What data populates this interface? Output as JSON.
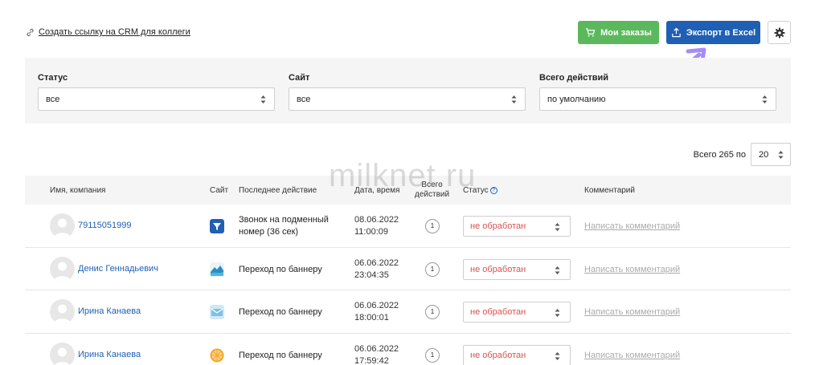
{
  "header": {
    "crm_link": "Создать ссылку на CRM для коллеги",
    "orders_button": "Мои заказы",
    "export_button": "Экспорт в Excel",
    "colors": {
      "green": "#5cb85c",
      "blue": "#1f5fb4",
      "arrow": "#a78bfa"
    }
  },
  "filters": {
    "status": {
      "label": "Статус",
      "value": "все"
    },
    "site": {
      "label": "Сайт",
      "value": "все"
    },
    "actions": {
      "label": "Всего действий",
      "value": "по умолчанию"
    }
  },
  "pagination": {
    "total": "Всего 265 по",
    "per_page": "20"
  },
  "watermark": "milknet.ru",
  "table": {
    "headers": {
      "name": "Имя, компания",
      "site": "Сайт",
      "last_action": "Последнее действие",
      "datetime": "Дата, время",
      "actions_line1": "Всего",
      "actions_line2": "действий",
      "status": "Статус",
      "comment": "Комментарий"
    },
    "rows": [
      {
        "name": "79115051999",
        "site_icon": "funnel-site-icon",
        "last_action": "Звонок на подменный номер (36 сек)",
        "date": "08.06.2022",
        "time": "11:00:09",
        "count": "1",
        "status": "не обработан",
        "comment": "Написать комментарий"
      },
      {
        "name": "Денис Геннадьевич",
        "site_icon": "wave-site-icon",
        "last_action": "Переход по баннеру",
        "date": "06.06.2022",
        "time": "23:04:35",
        "count": "1",
        "status": "не обработан",
        "comment": "Написать комментарий"
      },
      {
        "name": "Ирина Канаева",
        "site_icon": "envelope-site-icon",
        "last_action": "Переход по баннеру",
        "date": "06.06.2022",
        "time": "18:00:01",
        "count": "1",
        "status": "не обработан",
        "comment": "Написать комментарий"
      },
      {
        "name": "Ирина Канаева",
        "site_icon": "orange-site-icon",
        "last_action": "Переход по баннеру",
        "date": "06.06.2022",
        "time": "17:59:42",
        "count": "1",
        "status": "не обработан",
        "comment": "Написать комментарий"
      }
    ]
  }
}
